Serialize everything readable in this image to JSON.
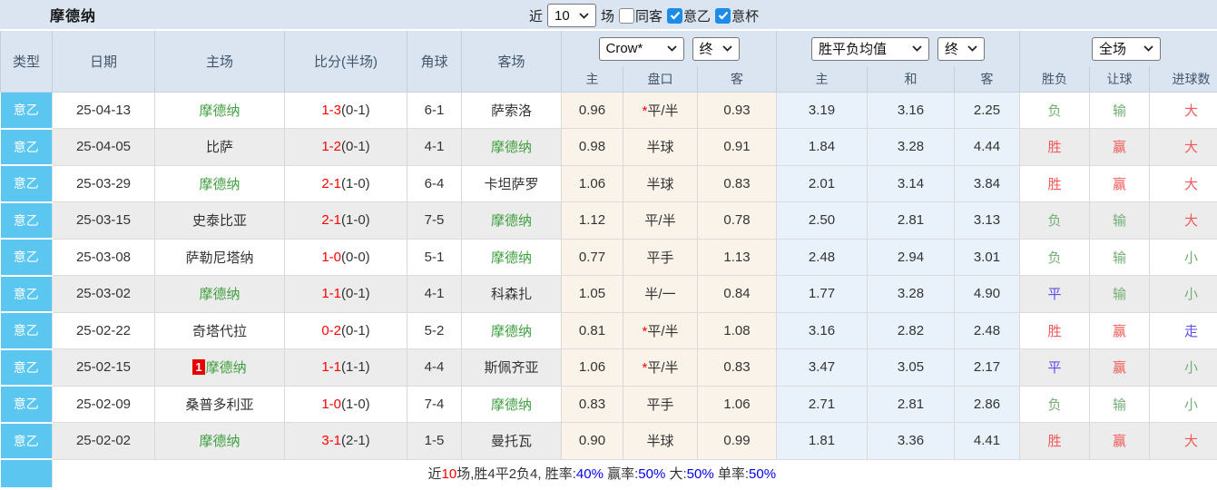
{
  "team": "摩德纳",
  "title_bar": {
    "title": "摩德纳",
    "recent_label": "近",
    "recent_select": "10",
    "matches_label": "场",
    "checkboxes": [
      {
        "label": "同客",
        "state": "unchecked"
      },
      {
        "label": "意乙",
        "state": "checked"
      },
      {
        "label": "意杯",
        "state": "checked"
      }
    ]
  },
  "table": {
    "main_headers": [
      "类型",
      "日期",
      "主场",
      "比分(半场)",
      "角球",
      "客场"
    ],
    "dropdowns": {
      "asian_company": "Crow*",
      "asian_time": "终",
      "europe_company": "胜平负均值",
      "europe_time": "终",
      "result_scope": "全场"
    },
    "sub_headers": [
      "主",
      "盘口",
      "客",
      "主",
      "和",
      "客",
      "胜负",
      "让球",
      "进球数"
    ],
    "rows": [
      {
        "type": "意乙",
        "date": "25-04-13",
        "home": "摩德纳",
        "badge": "",
        "score": "1-3",
        "half": "(0-1)",
        "corner": "6-1",
        "away": "萨索洛",
        "ah_home": "0.96",
        "ah_star": "*",
        "ah_line": "平/半",
        "ah_away": "0.93",
        "eu_home": "3.19",
        "eu_draw": "3.16",
        "eu_away": "2.25",
        "wl": "负",
        "hc": "输",
        "goal": "大"
      },
      {
        "type": "意乙",
        "date": "25-04-05",
        "home": "比萨",
        "badge": "",
        "score": "1-2",
        "half": "(0-1)",
        "corner": "4-1",
        "away": "摩德纳",
        "ah_home": "0.98",
        "ah_star": "",
        "ah_line": "半球",
        "ah_away": "0.91",
        "eu_home": "1.84",
        "eu_draw": "3.28",
        "eu_away": "4.44",
        "wl": "胜",
        "hc": "赢",
        "goal": "大"
      },
      {
        "type": "意乙",
        "date": "25-03-29",
        "home": "摩德纳",
        "badge": "",
        "score": "2-1",
        "half": "(1-0)",
        "corner": "6-4",
        "away": "卡坦萨罗",
        "ah_home": "1.06",
        "ah_star": "",
        "ah_line": "半球",
        "ah_away": "0.83",
        "eu_home": "2.01",
        "eu_draw": "3.14",
        "eu_away": "3.84",
        "wl": "胜",
        "hc": "赢",
        "goal": "大"
      },
      {
        "type": "意乙",
        "date": "25-03-15",
        "home": "史泰比亚",
        "badge": "",
        "score": "2-1",
        "half": "(1-0)",
        "corner": "7-5",
        "away": "摩德纳",
        "ah_home": "1.12",
        "ah_star": "",
        "ah_line": "平/半",
        "ah_away": "0.78",
        "eu_home": "2.50",
        "eu_draw": "2.81",
        "eu_away": "3.13",
        "wl": "负",
        "hc": "输",
        "goal": "大"
      },
      {
        "type": "意乙",
        "date": "25-03-08",
        "home": "萨勒尼塔纳",
        "badge": "",
        "score": "1-0",
        "half": "(0-0)",
        "corner": "5-1",
        "away": "摩德纳",
        "ah_home": "0.77",
        "ah_star": "",
        "ah_line": "平手",
        "ah_away": "1.13",
        "eu_home": "2.48",
        "eu_draw": "2.94",
        "eu_away": "3.01",
        "wl": "负",
        "hc": "输",
        "goal": "小"
      },
      {
        "type": "意乙",
        "date": "25-03-02",
        "home": "摩德纳",
        "badge": "",
        "score": "1-1",
        "half": "(0-1)",
        "corner": "4-1",
        "away": "科森扎",
        "ah_home": "1.05",
        "ah_star": "",
        "ah_line": "半/一",
        "ah_away": "0.84",
        "eu_home": "1.77",
        "eu_draw": "3.28",
        "eu_away": "4.90",
        "wl": "平",
        "hc": "输",
        "goal": "小"
      },
      {
        "type": "意乙",
        "date": "25-02-22",
        "home": "奇塔代拉",
        "badge": "",
        "score": "0-2",
        "half": "(0-1)",
        "corner": "5-2",
        "away": "摩德纳",
        "ah_home": "0.81",
        "ah_star": "*",
        "ah_line": "平/半",
        "ah_away": "1.08",
        "eu_home": "3.16",
        "eu_draw": "2.82",
        "eu_away": "2.48",
        "wl": "胜",
        "hc": "赢",
        "goal": "走"
      },
      {
        "type": "意乙",
        "date": "25-02-15",
        "home": "摩德纳",
        "badge": "1",
        "score": "1-1",
        "half": "(1-1)",
        "corner": "4-4",
        "away": "斯佩齐亚",
        "ah_home": "1.06",
        "ah_star": "*",
        "ah_line": "平/半",
        "ah_away": "0.83",
        "eu_home": "3.47",
        "eu_draw": "3.05",
        "eu_away": "2.17",
        "wl": "平",
        "hc": "赢",
        "goal": "小"
      },
      {
        "type": "意乙",
        "date": "25-02-09",
        "home": "桑普多利亚",
        "badge": "",
        "score": "1-0",
        "half": "(1-0)",
        "corner": "7-4",
        "away": "摩德纳",
        "ah_home": "0.83",
        "ah_star": "",
        "ah_line": "平手",
        "ah_away": "1.06",
        "eu_home": "2.71",
        "eu_draw": "2.81",
        "eu_away": "2.86",
        "wl": "负",
        "hc": "输",
        "goal": "小"
      },
      {
        "type": "意乙",
        "date": "25-02-02",
        "home": "摩德纳",
        "badge": "",
        "score": "3-1",
        "half": "(2-1)",
        "corner": "1-5",
        "away": "曼托瓦",
        "ah_home": "0.90",
        "ah_star": "",
        "ah_line": "半球",
        "ah_away": "0.99",
        "eu_home": "1.81",
        "eu_draw": "3.36",
        "eu_away": "4.41",
        "wl": "胜",
        "hc": "赢",
        "goal": "大"
      }
    ]
  },
  "footer": {
    "segments": [
      {
        "text": "近",
        "color": "dark"
      },
      {
        "text": "10",
        "color": "red"
      },
      {
        "text": "场,胜4平2负4, 胜率:",
        "color": "dark"
      },
      {
        "text": "40%",
        "color": "blue"
      },
      {
        "text": " 赢率:",
        "color": "dark"
      },
      {
        "text": "50%",
        "color": "blue"
      },
      {
        "text": " 大:",
        "color": "dark"
      },
      {
        "text": "50%",
        "color": "blue"
      },
      {
        "text": " 单率:",
        "color": "dark"
      },
      {
        "text": "50%",
        "color": "blue"
      }
    ]
  }
}
